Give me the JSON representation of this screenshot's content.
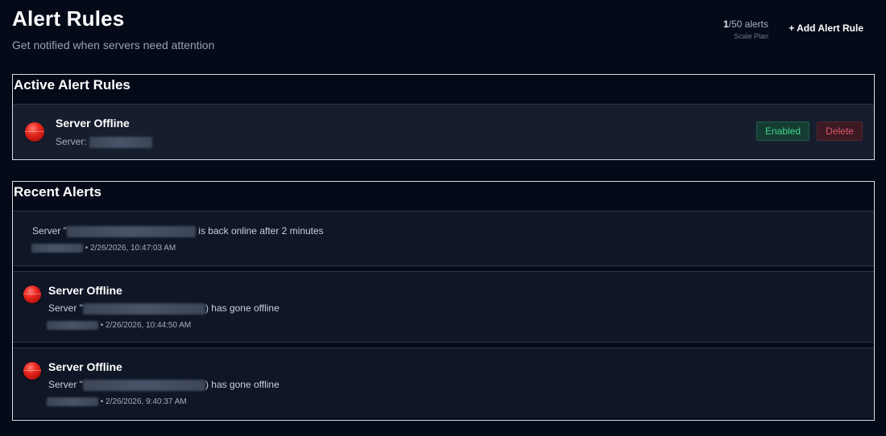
{
  "header": {
    "title": "Alert Rules",
    "subtitle": "Get notified when servers need attention"
  },
  "usage": {
    "used": "1",
    "limit_text": "/50 alerts",
    "plan": "Scale Plan"
  },
  "actions": {
    "add_label": "+ Add Alert Rule"
  },
  "active_rules": {
    "title": "Active Alert Rules",
    "items": [
      {
        "name": "Server Offline",
        "server_label": "Server:",
        "enabled_label": "Enabled",
        "delete_label": "Delete"
      }
    ]
  },
  "recent_alerts": {
    "title": "Recent Alerts",
    "items": [
      {
        "message_prefix": "Server \"",
        "message_suffix": " is back online after 2 minutes",
        "timestamp": " • 2/26/2026, 10:47:03 AM"
      },
      {
        "title": "Server Offline",
        "message_prefix": "Server \"",
        "message_suffix": ") has gone offline",
        "timestamp": " • 2/26/2026, 10:44:50 AM"
      },
      {
        "title": "Server Offline",
        "message_prefix": "Server \"",
        "message_suffix": ") has gone offline",
        "timestamp": " • 2/26/2026, 9:40:37 AM"
      }
    ]
  },
  "colors": {
    "background": "#050a18",
    "row": "#161e2e",
    "enabled": "#3fd48c",
    "delete": "#e0566a",
    "offline_dot": "#e8261e"
  },
  "icons": {
    "offline": "red-circle-icon"
  }
}
